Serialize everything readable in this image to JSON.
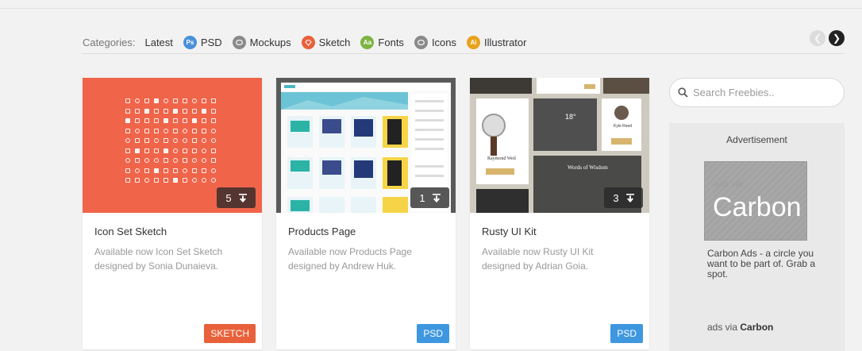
{
  "categories": {
    "label": "Categories:",
    "items": [
      {
        "label": "Latest",
        "badge": "",
        "color": ""
      },
      {
        "label": "PSD",
        "badge": "Ps",
        "color": "#4a90d9"
      },
      {
        "label": "Mockups",
        "badge": "",
        "color": "#8a8a8a"
      },
      {
        "label": "Sketch",
        "badge": "",
        "color": "#e8613a"
      },
      {
        "label": "Fonts",
        "badge": "Aa",
        "color": "#7cb342"
      },
      {
        "label": "Icons",
        "badge": "",
        "color": "#8a8a8a"
      },
      {
        "label": "Illustrator",
        "badge": "Ai",
        "color": "#e8a21a"
      }
    ]
  },
  "cards": [
    {
      "title": "Icon Set Sketch",
      "description": "Available now Icon Set Sketch designed by Sonia Dunaieva.",
      "downloads": "5",
      "tag": "SKETCH",
      "tag_color": "#e8613a"
    },
    {
      "title": "Products Page",
      "description": "Available now Products Page designed by Andrew Huk.",
      "downloads": "1",
      "tag": "PSD",
      "tag_color": "#3f97e0"
    },
    {
      "title": "Rusty UI Kit",
      "description": "Available now Rusty UI Kit designed by Adrian Goia.",
      "downloads": "3",
      "tag": "PSD",
      "tag_color": "#3f97e0"
    }
  ],
  "thumbs": {
    "card3": {
      "watch_name": "Raymond Weil",
      "weather_temp": "18°",
      "profile_name": "Kyle Reed",
      "words_title": "Words of Wisdom"
    }
  },
  "sidebar": {
    "search_placeholder": "Search Freebies..",
    "ad_heading": "Advertisement",
    "ad_logo_small": "ads via",
    "ad_logo": "Carbon",
    "ad_text": "Carbon Ads - a circle you want to be part of. Grab a spot.",
    "ad_via_prefix": "ads via",
    "ad_via_brand": "Carbon"
  }
}
